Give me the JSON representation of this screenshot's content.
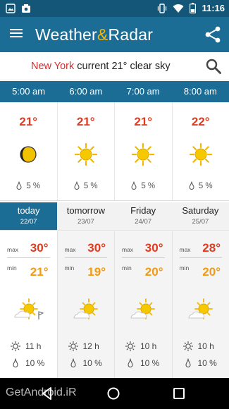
{
  "status_bar": {
    "time": "11:16",
    "left_icons": [
      "image-icon",
      "photo-icon"
    ],
    "right_icons": [
      "vibrate-icon",
      "wifi-icon",
      "battery-icon"
    ]
  },
  "app_bar": {
    "brand_part1": "Weather",
    "brand_amp": "&",
    "brand_part2": "Radar",
    "menu_icon": "menu-icon",
    "share_icon": "share-icon"
  },
  "location": {
    "city": "New York",
    "word": "current",
    "temp": "21°",
    "condition": "clear sky"
  },
  "hourly": [
    {
      "time": "5:00 am",
      "temp": "21°",
      "icon": "moon-icon",
      "rain": "5 %"
    },
    {
      "time": "6:00 am",
      "temp": "21°",
      "icon": "sun-icon",
      "rain": "5 %"
    },
    {
      "time": "7:00 am",
      "temp": "21°",
      "icon": "sun-icon",
      "rain": "5 %"
    },
    {
      "time": "8:00 am",
      "temp": "22°",
      "icon": "sun-icon",
      "rain": "5 %"
    }
  ],
  "daily": [
    {
      "name": "today",
      "date": "22/07",
      "max_label": "max",
      "max": "30°",
      "min_label": "min",
      "min": "21°",
      "icon": "sun-cloud-wind-icon",
      "sun_hours": "11 h",
      "rain": "10 %"
    },
    {
      "name": "tomorrow",
      "date": "23/07",
      "max_label": "max",
      "max": "30°",
      "min_label": "min",
      "min": "19°",
      "icon": "sun-cloud-icon",
      "sun_hours": "12 h",
      "rain": "10 %"
    },
    {
      "name": "Friday",
      "date": "24/07",
      "max_label": "max",
      "max": "30°",
      "min_label": "min",
      "min": "20°",
      "icon": "sun-cloud-icon",
      "sun_hours": "10 h",
      "rain": "10 %"
    },
    {
      "name": "Saturday",
      "date": "25/07",
      "max_label": "max",
      "max": "28°",
      "min_label": "min",
      "min": "20°",
      "icon": "sun-cloud-icon",
      "sun_hours": "10 h",
      "rain": "10 %"
    }
  ],
  "nav_bar": {
    "watermark": "GetAndroid.iR",
    "buttons": [
      "back-icon",
      "home-icon",
      "recent-apps-icon"
    ]
  },
  "colors": {
    "app_bar": "#1b6d95",
    "status_bar": "#145678",
    "accent_amp": "#f5b800",
    "city": "#d32f2f",
    "max_temp": "#e03a1f",
    "min_temp": "#f29a12"
  }
}
